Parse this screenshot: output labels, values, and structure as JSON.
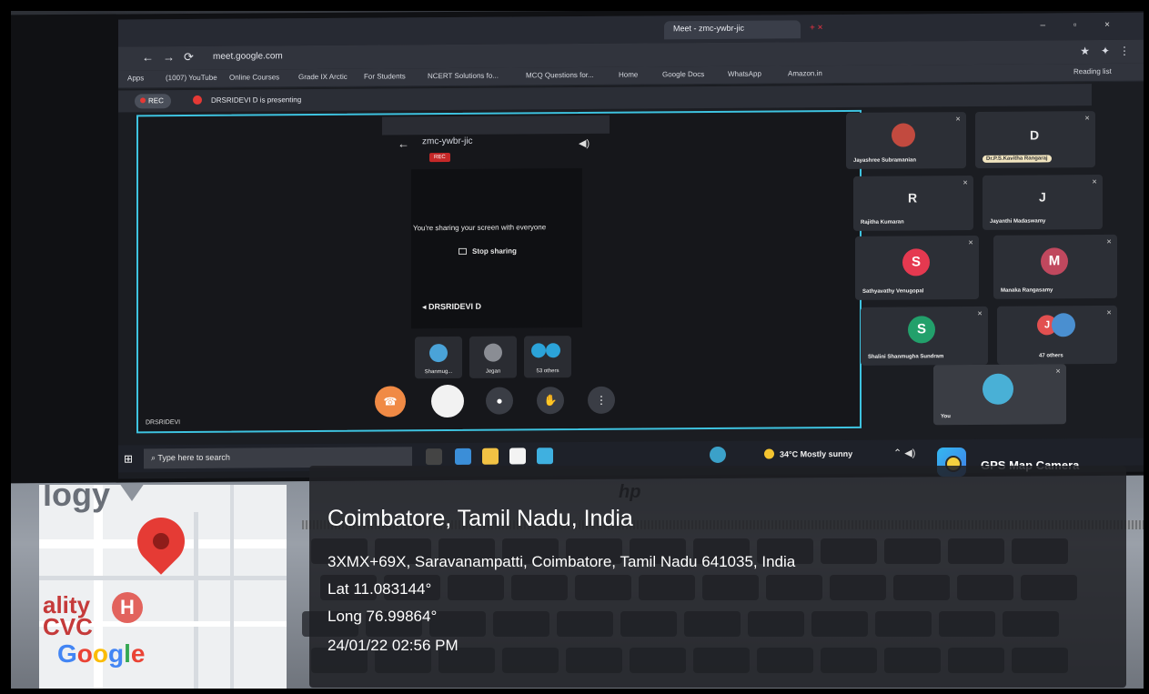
{
  "browser": {
    "tabs": [
      "Meet - zmc-ywbr-jic"
    ],
    "url": "meet.google.com",
    "bookmarks": [
      "Apps",
      "(1007) YouTube",
      "Online Courses",
      "Grade IX Arctic",
      "For Students",
      "NCERT Solutions fo...",
      "MCQ Questions for...",
      "Home",
      "Google Docs",
      "WhatsApp",
      "Amazon.in",
      "Reading list"
    ]
  },
  "meet": {
    "rec_label": "REC",
    "presenting_banner": "DRSRIDEVI D is presenting",
    "meeting_code": "zmc-ywbr-jic",
    "rec_badge": "REC",
    "share_message": "You're sharing your screen with everyone",
    "stop_sharing": "Stop sharing",
    "presenter_name": "DRSRIDEVI D",
    "panel_name": "DRSRIDEVI",
    "mini_tiles": [
      "Shanmug...",
      "Jegan",
      "53 others"
    ],
    "participants": [
      {
        "name": "Jayashree Subramanian"
      },
      {
        "name": "Dr.P.S.Kavitha Rangaraj",
        "letter": "D"
      },
      {
        "name": "Rajitha Kumaran",
        "letter": "R"
      },
      {
        "name": "Jayanthi Madaswamy",
        "letter": "J"
      },
      {
        "name": "Sathyavathy Venugopal",
        "letter": "S"
      },
      {
        "name": "Manaka Rangasamy",
        "letter": "M"
      },
      {
        "name": "Shalini Shanmugha Sundram",
        "letter": "S"
      },
      {
        "name": "47 others",
        "letter": "J"
      },
      {
        "name": "You"
      }
    ]
  },
  "taskbar": {
    "search_placeholder": "Type here to search",
    "weather": "34°C Mostly sunny"
  },
  "gps": {
    "app_name": "GPS Map Camera",
    "city": "Coimbatore, Tamil Nadu, India",
    "address": "3XMX+69X, Saravanampatti, Coimbatore, Tamil Nadu 641035, India",
    "lat": "Lat 11.083144°",
    "long": "Long 76.99864°",
    "datetime": "24/01/22 02:56 PM"
  },
  "map": {
    "label_top": "logy",
    "label_left": "ality",
    "label_left2": "CVC",
    "hospital_letter": "H",
    "brand_letters": [
      "G",
      "o",
      "o",
      "g",
      "l",
      "e"
    ]
  },
  "laptop_brand": "hp"
}
